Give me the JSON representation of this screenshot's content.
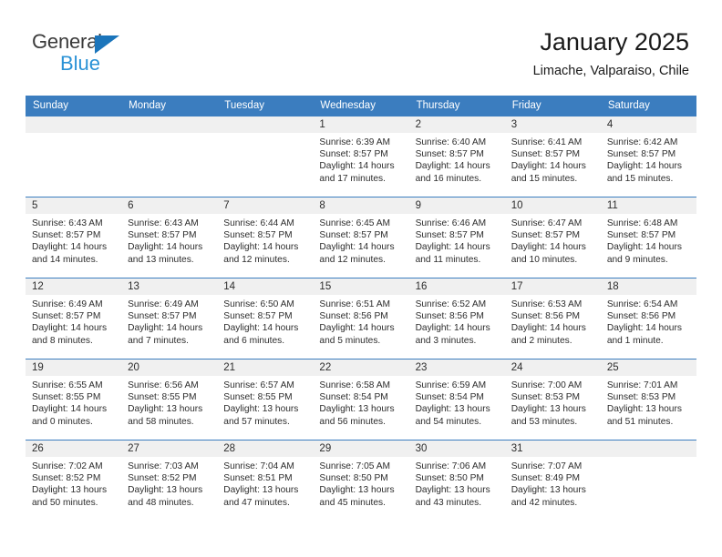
{
  "brand": {
    "name_part1": "General",
    "name_part2": "Blue",
    "triangle_color": "#1b75bb",
    "blue_text_color": "#2a92d6"
  },
  "header": {
    "title": "January 2025",
    "subtitle": "Limache, Valparaiso, Chile"
  },
  "theme": {
    "header_row_bg": "#3b7dbf",
    "header_row_text": "#ffffff",
    "daynum_bg": "#f0f0f0",
    "grid_line": "#3b7dbf"
  },
  "weekday_headers": [
    "Sunday",
    "Monday",
    "Tuesday",
    "Wednesday",
    "Thursday",
    "Friday",
    "Saturday"
  ],
  "weeks": [
    [
      {
        "day": "",
        "lines": []
      },
      {
        "day": "",
        "lines": []
      },
      {
        "day": "",
        "lines": []
      },
      {
        "day": "1",
        "lines": [
          "Sunrise: 6:39 AM",
          "Sunset: 8:57 PM",
          "Daylight: 14 hours",
          "and 17 minutes."
        ]
      },
      {
        "day": "2",
        "lines": [
          "Sunrise: 6:40 AM",
          "Sunset: 8:57 PM",
          "Daylight: 14 hours",
          "and 16 minutes."
        ]
      },
      {
        "day": "3",
        "lines": [
          "Sunrise: 6:41 AM",
          "Sunset: 8:57 PM",
          "Daylight: 14 hours",
          "and 15 minutes."
        ]
      },
      {
        "day": "4",
        "lines": [
          "Sunrise: 6:42 AM",
          "Sunset: 8:57 PM",
          "Daylight: 14 hours",
          "and 15 minutes."
        ]
      }
    ],
    [
      {
        "day": "5",
        "lines": [
          "Sunrise: 6:43 AM",
          "Sunset: 8:57 PM",
          "Daylight: 14 hours",
          "and 14 minutes."
        ]
      },
      {
        "day": "6",
        "lines": [
          "Sunrise: 6:43 AM",
          "Sunset: 8:57 PM",
          "Daylight: 14 hours",
          "and 13 minutes."
        ]
      },
      {
        "day": "7",
        "lines": [
          "Sunrise: 6:44 AM",
          "Sunset: 8:57 PM",
          "Daylight: 14 hours",
          "and 12 minutes."
        ]
      },
      {
        "day": "8",
        "lines": [
          "Sunrise: 6:45 AM",
          "Sunset: 8:57 PM",
          "Daylight: 14 hours",
          "and 12 minutes."
        ]
      },
      {
        "day": "9",
        "lines": [
          "Sunrise: 6:46 AM",
          "Sunset: 8:57 PM",
          "Daylight: 14 hours",
          "and 11 minutes."
        ]
      },
      {
        "day": "10",
        "lines": [
          "Sunrise: 6:47 AM",
          "Sunset: 8:57 PM",
          "Daylight: 14 hours",
          "and 10 minutes."
        ]
      },
      {
        "day": "11",
        "lines": [
          "Sunrise: 6:48 AM",
          "Sunset: 8:57 PM",
          "Daylight: 14 hours",
          "and 9 minutes."
        ]
      }
    ],
    [
      {
        "day": "12",
        "lines": [
          "Sunrise: 6:49 AM",
          "Sunset: 8:57 PM",
          "Daylight: 14 hours",
          "and 8 minutes."
        ]
      },
      {
        "day": "13",
        "lines": [
          "Sunrise: 6:49 AM",
          "Sunset: 8:57 PM",
          "Daylight: 14 hours",
          "and 7 minutes."
        ]
      },
      {
        "day": "14",
        "lines": [
          "Sunrise: 6:50 AM",
          "Sunset: 8:57 PM",
          "Daylight: 14 hours",
          "and 6 minutes."
        ]
      },
      {
        "day": "15",
        "lines": [
          "Sunrise: 6:51 AM",
          "Sunset: 8:56 PM",
          "Daylight: 14 hours",
          "and 5 minutes."
        ]
      },
      {
        "day": "16",
        "lines": [
          "Sunrise: 6:52 AM",
          "Sunset: 8:56 PM",
          "Daylight: 14 hours",
          "and 3 minutes."
        ]
      },
      {
        "day": "17",
        "lines": [
          "Sunrise: 6:53 AM",
          "Sunset: 8:56 PM",
          "Daylight: 14 hours",
          "and 2 minutes."
        ]
      },
      {
        "day": "18",
        "lines": [
          "Sunrise: 6:54 AM",
          "Sunset: 8:56 PM",
          "Daylight: 14 hours",
          "and 1 minute."
        ]
      }
    ],
    [
      {
        "day": "19",
        "lines": [
          "Sunrise: 6:55 AM",
          "Sunset: 8:55 PM",
          "Daylight: 14 hours",
          "and 0 minutes."
        ]
      },
      {
        "day": "20",
        "lines": [
          "Sunrise: 6:56 AM",
          "Sunset: 8:55 PM",
          "Daylight: 13 hours",
          "and 58 minutes."
        ]
      },
      {
        "day": "21",
        "lines": [
          "Sunrise: 6:57 AM",
          "Sunset: 8:55 PM",
          "Daylight: 13 hours",
          "and 57 minutes."
        ]
      },
      {
        "day": "22",
        "lines": [
          "Sunrise: 6:58 AM",
          "Sunset: 8:54 PM",
          "Daylight: 13 hours",
          "and 56 minutes."
        ]
      },
      {
        "day": "23",
        "lines": [
          "Sunrise: 6:59 AM",
          "Sunset: 8:54 PM",
          "Daylight: 13 hours",
          "and 54 minutes."
        ]
      },
      {
        "day": "24",
        "lines": [
          "Sunrise: 7:00 AM",
          "Sunset: 8:53 PM",
          "Daylight: 13 hours",
          "and 53 minutes."
        ]
      },
      {
        "day": "25",
        "lines": [
          "Sunrise: 7:01 AM",
          "Sunset: 8:53 PM",
          "Daylight: 13 hours",
          "and 51 minutes."
        ]
      }
    ],
    [
      {
        "day": "26",
        "lines": [
          "Sunrise: 7:02 AM",
          "Sunset: 8:52 PM",
          "Daylight: 13 hours",
          "and 50 minutes."
        ]
      },
      {
        "day": "27",
        "lines": [
          "Sunrise: 7:03 AM",
          "Sunset: 8:52 PM",
          "Daylight: 13 hours",
          "and 48 minutes."
        ]
      },
      {
        "day": "28",
        "lines": [
          "Sunrise: 7:04 AM",
          "Sunset: 8:51 PM",
          "Daylight: 13 hours",
          "and 47 minutes."
        ]
      },
      {
        "day": "29",
        "lines": [
          "Sunrise: 7:05 AM",
          "Sunset: 8:50 PM",
          "Daylight: 13 hours",
          "and 45 minutes."
        ]
      },
      {
        "day": "30",
        "lines": [
          "Sunrise: 7:06 AM",
          "Sunset: 8:50 PM",
          "Daylight: 13 hours",
          "and 43 minutes."
        ]
      },
      {
        "day": "31",
        "lines": [
          "Sunrise: 7:07 AM",
          "Sunset: 8:49 PM",
          "Daylight: 13 hours",
          "and 42 minutes."
        ]
      },
      {
        "day": "",
        "lines": []
      }
    ]
  ]
}
